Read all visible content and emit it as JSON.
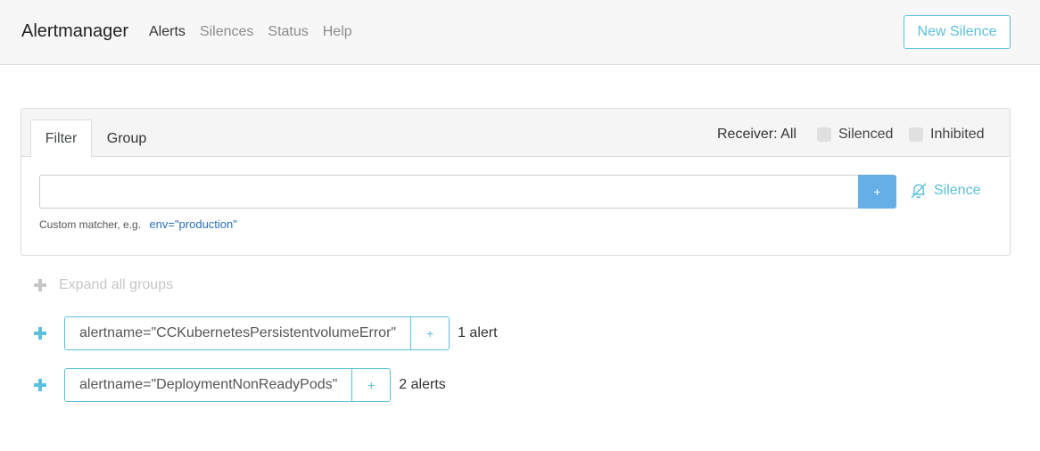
{
  "app": {
    "brand": "Alertmanager"
  },
  "nav": {
    "items": [
      "Alerts",
      "Silences",
      "Status",
      "Help"
    ],
    "active": "Alerts"
  },
  "header": {
    "new_silence": "New Silence"
  },
  "filter_panel": {
    "tabs": [
      "Filter",
      "Group"
    ],
    "receiver": "Receiver: All",
    "silenced_label": "Silenced",
    "inhibited_label": "Inhibited",
    "input_value": "",
    "add_button": "+",
    "silence_link": "Silence",
    "hint_text": "Custom matcher, e.g.",
    "hint_example": "env=\"production\""
  },
  "expand_all": "Expand all groups",
  "groups": [
    {
      "matcher": "alertname=\"CCKubernetesPersistentvolumeError\"",
      "add": "+",
      "count": "1 alert"
    },
    {
      "matcher": "alertname=\"DeploymentNonReadyPods\"",
      "add": "+",
      "count": "2 alerts"
    }
  ],
  "colors": {
    "accent": "#5bc0de",
    "button_primary": "#66aee6",
    "link": "#2a6ebb",
    "muted": "#c7c7c7"
  }
}
